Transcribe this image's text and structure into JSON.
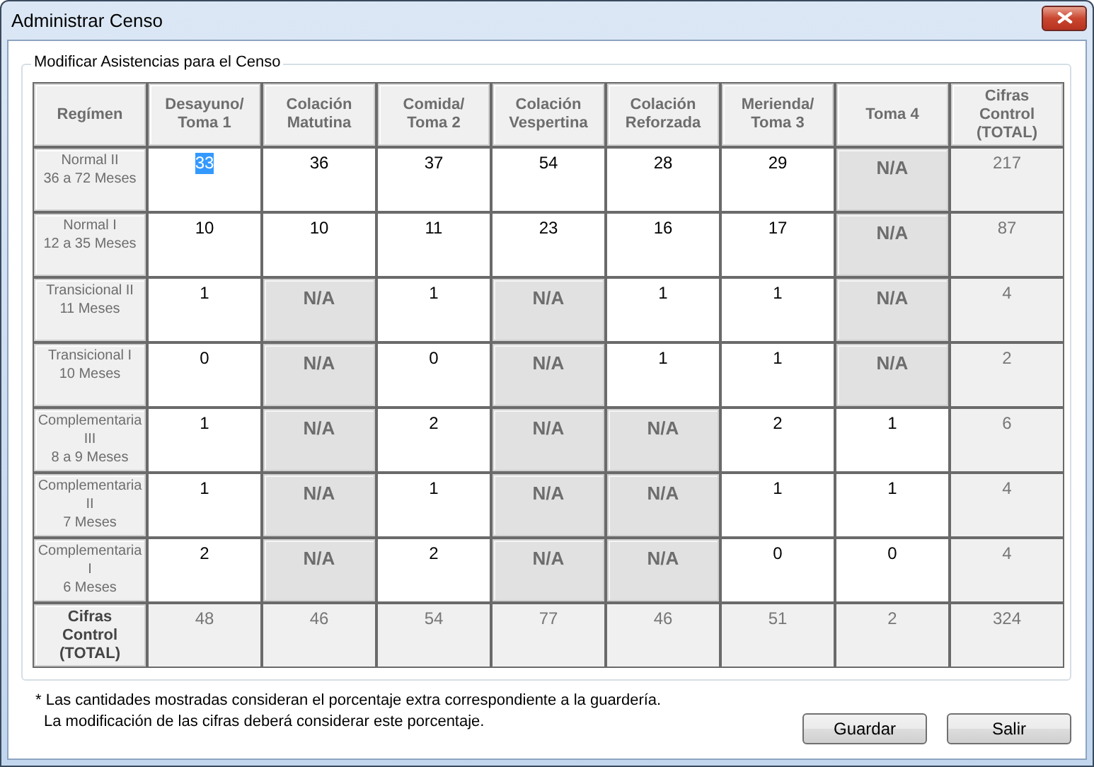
{
  "window": {
    "title": "Administrar Censo"
  },
  "group": {
    "title": "Modificar Asistencias para el Censo"
  },
  "table": {
    "columns": [
      "Regímen",
      "Desayuno/\nToma 1",
      "Colación\nMatutina",
      "Comida/\nToma 2",
      "Colación\nVespertina",
      "Colación\nReforzada",
      "Merienda/\nToma 3",
      "Toma 4",
      "Cifras\nControl\n(TOTAL)"
    ],
    "rows": [
      {
        "cells": [
          {
            "kind": "label",
            "text": "Normal II\n36 a 72 Meses"
          },
          {
            "kind": "input",
            "text": "33",
            "selected": true
          },
          {
            "kind": "input",
            "text": "36",
            "selected": false
          },
          {
            "kind": "input",
            "text": "37",
            "selected": false
          },
          {
            "kind": "input",
            "text": "54",
            "selected": false
          },
          {
            "kind": "input",
            "text": "28",
            "selected": false
          },
          {
            "kind": "input",
            "text": "29",
            "selected": false
          },
          {
            "kind": "na",
            "text": "N/A"
          },
          {
            "kind": "total",
            "text": "217"
          }
        ]
      },
      {
        "cells": [
          {
            "kind": "label",
            "text": "Normal I\n12 a 35 Meses"
          },
          {
            "kind": "input",
            "text": "10",
            "selected": false
          },
          {
            "kind": "input",
            "text": "10",
            "selected": false
          },
          {
            "kind": "input",
            "text": "11",
            "selected": false
          },
          {
            "kind": "input",
            "text": "23",
            "selected": false
          },
          {
            "kind": "input",
            "text": "16",
            "selected": false
          },
          {
            "kind": "input",
            "text": "17",
            "selected": false
          },
          {
            "kind": "na",
            "text": "N/A"
          },
          {
            "kind": "total",
            "text": "87"
          }
        ]
      },
      {
        "cells": [
          {
            "kind": "label",
            "text": "Transicional II\n11 Meses"
          },
          {
            "kind": "input",
            "text": "1",
            "selected": false
          },
          {
            "kind": "na",
            "text": "N/A"
          },
          {
            "kind": "input",
            "text": "1",
            "selected": false
          },
          {
            "kind": "na",
            "text": "N/A"
          },
          {
            "kind": "input",
            "text": "1",
            "selected": false
          },
          {
            "kind": "input",
            "text": "1",
            "selected": false
          },
          {
            "kind": "na",
            "text": "N/A"
          },
          {
            "kind": "total",
            "text": "4"
          }
        ]
      },
      {
        "cells": [
          {
            "kind": "label",
            "text": "Transicional I\n10 Meses"
          },
          {
            "kind": "input",
            "text": "0",
            "selected": false
          },
          {
            "kind": "na",
            "text": "N/A"
          },
          {
            "kind": "input",
            "text": "0",
            "selected": false
          },
          {
            "kind": "na",
            "text": "N/A"
          },
          {
            "kind": "input",
            "text": "1",
            "selected": false
          },
          {
            "kind": "input",
            "text": "1",
            "selected": false
          },
          {
            "kind": "na",
            "text": "N/A"
          },
          {
            "kind": "total",
            "text": "2"
          }
        ]
      },
      {
        "cells": [
          {
            "kind": "label",
            "text": "Complementaria\nIII\n8 a 9 Meses"
          },
          {
            "kind": "input",
            "text": "1",
            "selected": false
          },
          {
            "kind": "na",
            "text": "N/A"
          },
          {
            "kind": "input",
            "text": "2",
            "selected": false
          },
          {
            "kind": "na",
            "text": "N/A"
          },
          {
            "kind": "na",
            "text": "N/A"
          },
          {
            "kind": "input",
            "text": "2",
            "selected": false
          },
          {
            "kind": "input",
            "text": "1",
            "selected": false
          },
          {
            "kind": "total",
            "text": "6"
          }
        ]
      },
      {
        "cells": [
          {
            "kind": "label",
            "text": "Complementaria\nII\n7 Meses"
          },
          {
            "kind": "input",
            "text": "1",
            "selected": false
          },
          {
            "kind": "na",
            "text": "N/A"
          },
          {
            "kind": "input",
            "text": "1",
            "selected": false
          },
          {
            "kind": "na",
            "text": "N/A"
          },
          {
            "kind": "na",
            "text": "N/A"
          },
          {
            "kind": "input",
            "text": "1",
            "selected": false
          },
          {
            "kind": "input",
            "text": "1",
            "selected": false
          },
          {
            "kind": "total",
            "text": "4"
          }
        ]
      },
      {
        "cells": [
          {
            "kind": "label",
            "text": "Complementaria\nI\n6 Meses"
          },
          {
            "kind": "input",
            "text": "2",
            "selected": false
          },
          {
            "kind": "na",
            "text": "N/A"
          },
          {
            "kind": "input",
            "text": "2",
            "selected": false
          },
          {
            "kind": "na",
            "text": "N/A"
          },
          {
            "kind": "na",
            "text": "N/A"
          },
          {
            "kind": "input",
            "text": "0",
            "selected": false
          },
          {
            "kind": "input",
            "text": "0",
            "selected": false
          },
          {
            "kind": "total",
            "text": "4"
          }
        ]
      },
      {
        "cells": [
          {
            "kind": "total_label",
            "text": "Cifras\nControl\n(TOTAL)"
          },
          {
            "kind": "total",
            "text": "48"
          },
          {
            "kind": "total",
            "text": "46"
          },
          {
            "kind": "total",
            "text": "54"
          },
          {
            "kind": "total",
            "text": "77"
          },
          {
            "kind": "total",
            "text": "46"
          },
          {
            "kind": "total",
            "text": "51"
          },
          {
            "kind": "total",
            "text": "2"
          },
          {
            "kind": "total",
            "text": "324"
          }
        ]
      }
    ]
  },
  "notes": [
    "* Las cantidades mostradas consideran el porcentaje extra correspondiente a la guardería.",
    "La modificación de las cifras deberá considerar este porcentaje."
  ],
  "buttons": [
    "Guardar",
    "Salir"
  ]
}
